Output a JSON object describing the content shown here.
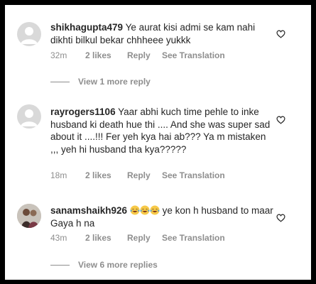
{
  "comments": [
    {
      "username": "shikhagupta479",
      "text": "Ye aurat kisi admi se kam nahi dikhti bilkul bekar chhheee yukkk",
      "time": "32m",
      "likes": "2 likes",
      "reply": "Reply",
      "translate": "See Translation"
    },
    {
      "username": "rayrogers1106",
      "text": "Yaar abhi kuch time pehle to inke husband ki death hue thi .... And she was super sad about it ....!!! Fer yeh kya hai ab??? Ya m mistaken ,,, yeh hi husband tha kya?????",
      "time": "18m",
      "likes": "2 likes",
      "reply": "Reply",
      "translate": "See Translation"
    },
    {
      "username": "sanamshaikh926",
      "text_after_emoji": "ye kon h husband to maar Gaya h na",
      "emoji": [
        "face-with-tears-of-joy",
        "face-with-tears-of-joy",
        "face-with-tears-of-joy"
      ],
      "time": "43m",
      "likes": "2 likes",
      "reply": "Reply",
      "translate": "See Translation"
    }
  ],
  "view_more": [
    {
      "label": "View 1 more reply"
    },
    {
      "label": "View 6 more replies"
    }
  ],
  "colors": {
    "text": "#262626",
    "muted": "#8e8e8e",
    "emoji_face": "#f7c948",
    "emoji_tears": "#4aa3df"
  },
  "icons": {
    "like": "heart-outline-icon",
    "default_avatar": "default-avatar-icon"
  }
}
